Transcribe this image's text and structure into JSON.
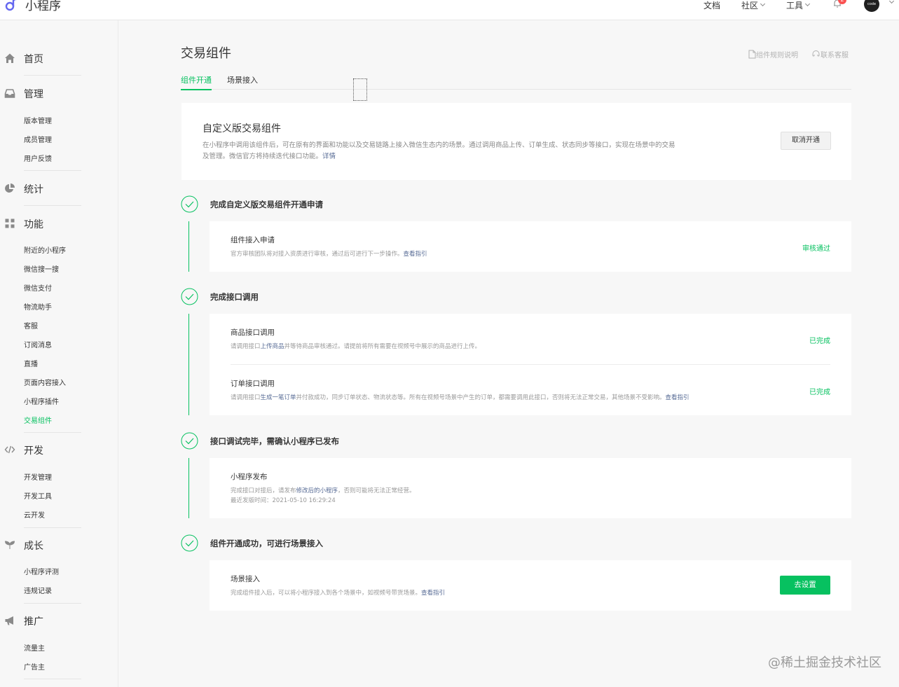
{
  "app": {
    "name": "小程序"
  },
  "topnav": {
    "docs": "文档",
    "community": "社区",
    "tools": "工具",
    "notification_count": "2",
    "avatar_text": "code"
  },
  "sidebar": {
    "home": "首页",
    "manage": {
      "label": "管理",
      "items": [
        "版本管理",
        "成员管理",
        "用户反馈"
      ]
    },
    "stats": "统计",
    "features": {
      "label": "功能",
      "items": [
        "附近的小程序",
        "微信搜一搜",
        "微信支付",
        "物流助手",
        "客服",
        "订阅消息",
        "直播",
        "页面内容接入",
        "小程序插件",
        "交易组件"
      ],
      "active": "交易组件"
    },
    "dev": {
      "label": "开发",
      "items": [
        "开发管理",
        "开发工具",
        "云开发"
      ]
    },
    "growth": {
      "label": "成长",
      "items": [
        "小程序评测",
        "违规记录"
      ]
    },
    "promote": {
      "label": "推广",
      "items": [
        "流量主",
        "广告主"
      ]
    }
  },
  "main": {
    "title": "交易组件",
    "help": {
      "rules": "组件规则说明",
      "contact": "联系客服"
    },
    "tabs": [
      "组件开通",
      "场景接入"
    ],
    "hero": {
      "title": "自定义版交易组件",
      "desc_line1": "在小程序中调用该组件后，可在原有的界面和功能以及交易链路上接入微信生态内的场景。通过调用商品上传、订单生成、状态同步等接口，实现在场景中的交易",
      "desc_line2": "及管理。微信官方将持续迭代接口功能。",
      "desc_link": "详情",
      "button": "取消开通"
    },
    "steps": [
      {
        "title": "完成自定义版交易组件开通申请",
        "items": [
          {
            "title": "组件接入申请",
            "desc": "官方审核团队将对接入资质进行审核，通过后可进行下一步操作。",
            "link": "查看指引",
            "status": "审核通过"
          }
        ]
      },
      {
        "title": "完成接口调用",
        "items": [
          {
            "title": "商品接口调用",
            "desc_pre": "请调用接口",
            "desc_link": "上传商品",
            "desc_post": "并等待商品审核通过。请提前将所有需要在视频号中展示的商品进行上传。",
            "status": "已完成"
          },
          {
            "title": "订单接口调用",
            "desc_pre": "请调用接口",
            "desc_link": "生成一笔订单",
            "desc_post": "并付款成功，同步订单状态、物流状态等。所有在视频号场景中产生的订单，都需要调用此接口，否则将无法正常交易，其他场景不受影响。",
            "link": "查看指引",
            "status": "已完成"
          }
        ]
      },
      {
        "title": "接口调试完毕，需确认小程序已发布",
        "items": [
          {
            "title": "小程序发布",
            "desc_pre": "完成接口对接后，请发布",
            "desc_link": "修改后的小程序",
            "desc_post": "，否则可能将无法正常经营。",
            "desc_line2": "最近发版时间：2021-05-10 16:29:24"
          }
        ]
      },
      {
        "title": "组件开通成功，可进行场景接入",
        "items": [
          {
            "title": "场景接入",
            "desc": "完成组件接入后，可以将小程序接入到各个场景中，如视频号带货场景。",
            "link": "查看指引",
            "button": "去设置"
          }
        ]
      }
    ]
  },
  "watermark": "@稀土掘金技术社区",
  "colors": {
    "accent": "#07c160",
    "link": "#576b95",
    "muted": "#9a9a9a"
  }
}
